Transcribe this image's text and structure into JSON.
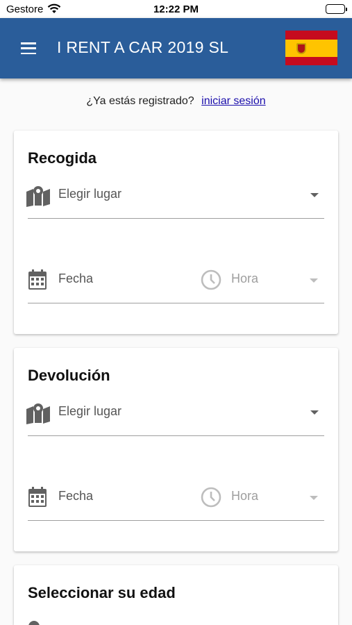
{
  "status_bar": {
    "carrier": "Gestore",
    "time": "12:22 PM"
  },
  "app_bar": {
    "title": "I RENT A CAR 2019 SL"
  },
  "login": {
    "question": "¿Ya estás registrado?",
    "link": "iniciar sesión"
  },
  "pickup": {
    "title": "Recogida",
    "place_placeholder": "Elegir lugar",
    "date_placeholder": "Fecha",
    "time_placeholder": "Hora"
  },
  "return": {
    "title": "Devolución",
    "place_placeholder": "Elegir lugar",
    "date_placeholder": "Fecha",
    "time_placeholder": "Hora"
  },
  "age": {
    "title": "Seleccionar su edad"
  },
  "colors": {
    "app_bar": "#2a5d9a",
    "link": "#1a0dab",
    "flag_red": "#c60b1e",
    "flag_yellow": "#ffc400"
  }
}
